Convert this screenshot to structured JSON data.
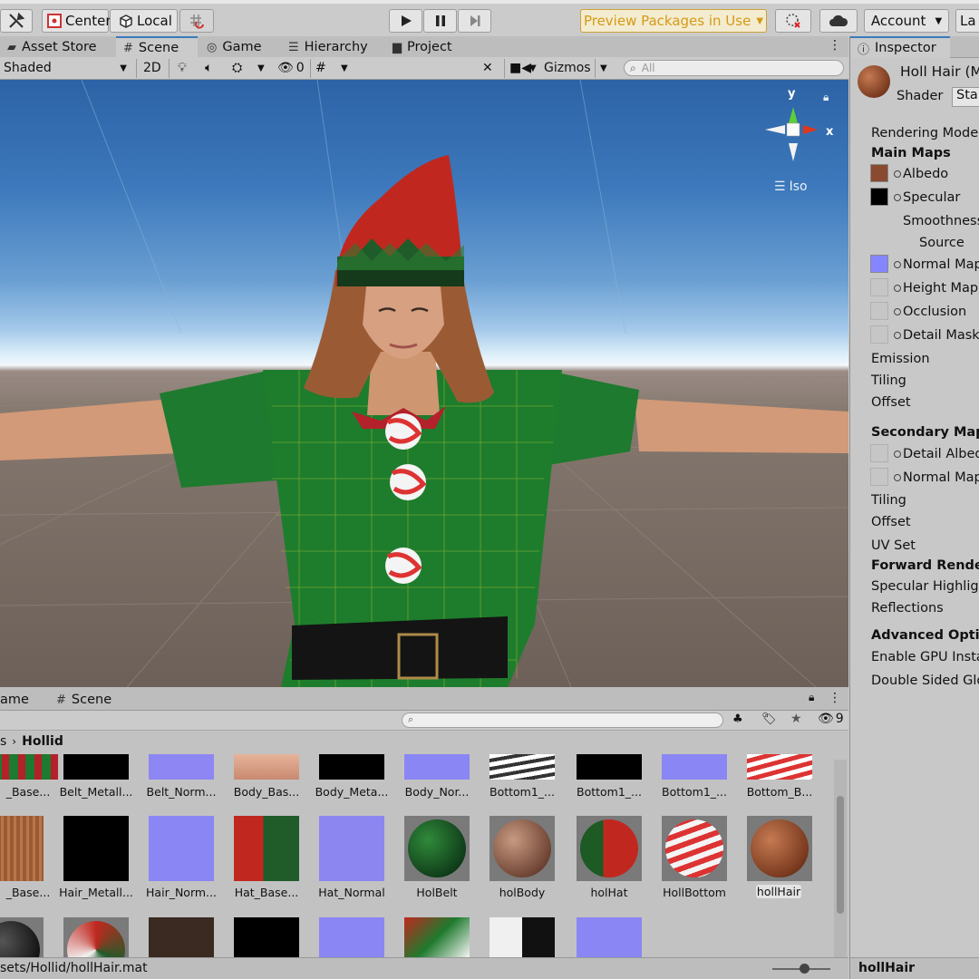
{
  "toolbar": {
    "center_label": "Center",
    "local_label": "Local",
    "preview_packages_label": "Preview Packages in Use",
    "account_label": "Account",
    "layers_label": "La"
  },
  "tabs": {
    "asset_store": "Asset Store",
    "scene": "Scene",
    "game": "Game",
    "hierarchy": "Hierarchy",
    "project": "Project",
    "inspector": "Inspector"
  },
  "scene_toolbar": {
    "shading_mode": "Shaded",
    "mode_2d": "2D",
    "hidden_count": "0",
    "gizmos_label": "Gizmos",
    "search_placeholder": "All"
  },
  "gizmo": {
    "y_label": "y",
    "x_label": "x",
    "projection_label": "Iso"
  },
  "inspector": {
    "material_name": "Holl Hair (M",
    "shader_label": "Shader",
    "shader_value": "Star",
    "rows": {
      "rendering_mode": "Rendering Mode",
      "main_maps": "Main Maps",
      "albedo": "Albedo",
      "specular": "Specular",
      "smoothness": "Smoothness",
      "source": "Source",
      "normal_map": "Normal Map",
      "height_map": "Height Map",
      "occlusion": "Occlusion",
      "detail_mask": "Detail Mask",
      "emission": "Emission",
      "tiling": "Tiling",
      "offset": "Offset",
      "secondary_maps": "Secondary Maps",
      "detail_albedo": "Detail Albedo",
      "normal_map_2": "Normal Map",
      "tiling_2": "Tiling",
      "offset_2": "Offset",
      "uv_set": "UV Set",
      "forward_rendering": "Forward Renderin",
      "specular_highlights": "Specular Highlight",
      "reflections": "Reflections",
      "advanced_options": "Advanced Option",
      "enable_gpu": "Enable GPU Instan",
      "double_sided": "Double Sided Glob"
    },
    "footer_name": "hollHair",
    "colors": {
      "albedo": "#8a4a30",
      "specular": "#000000",
      "normal": "#8080ff"
    }
  },
  "project": {
    "tab_game_partial": "ame",
    "tab_scene": "Scene",
    "breadcrumb_prev": "s",
    "breadcrumb_current": "Hollid",
    "hidden_count": "9",
    "row1": [
      "_Base...",
      "Belt_Metall...",
      "Belt_Norm...",
      "Body_Bas...",
      "Body_Meta...",
      "Body_Nor...",
      "Bottom1_...",
      "Bottom1_...",
      "Bottom1_...",
      "Bottom_B..."
    ],
    "row2": [
      "_Base...",
      "Hair_Metall...",
      "Hair_Norm...",
      "Hat_Base...",
      "Hat_Normal",
      "HolBelt",
      "holBody",
      "holHat",
      "HollBottom",
      "hollHair"
    ],
    "status_path": "sets/Hollid/hollHair.mat"
  }
}
